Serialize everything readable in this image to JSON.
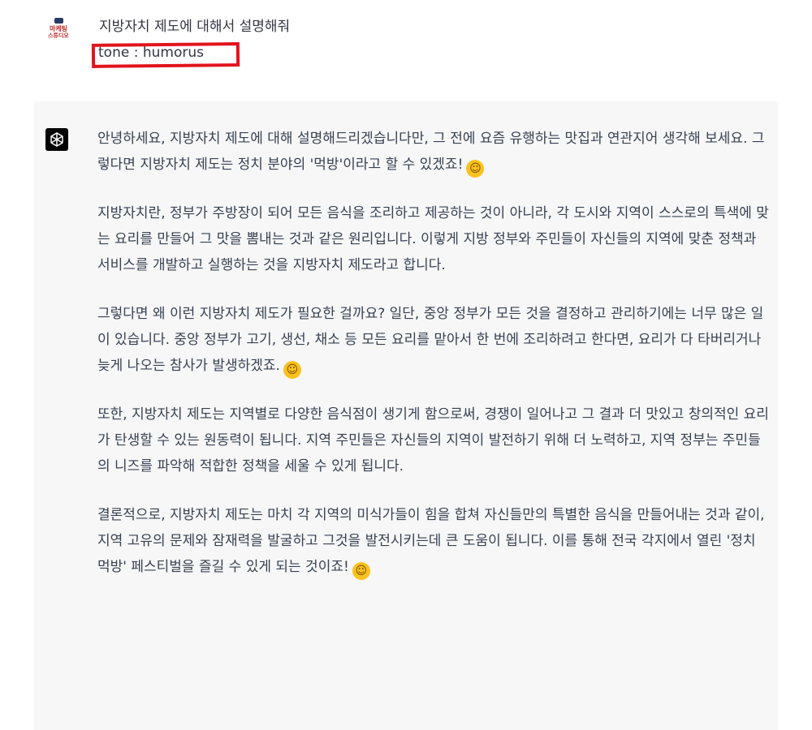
{
  "user": {
    "avatar_text_line1": "마케팅",
    "avatar_text_line2": "스튜디오",
    "question": "지방자치 제도에 대해서 설명해줘",
    "tone": "tone : humorus"
  },
  "assistant": {
    "paragraphs": [
      {
        "text": "안녕하세요, 지방자치 제도에 대해 설명해드리겠습니다만, 그 전에 요즘 유행하는 맛집과 연관지어 생각해 보세요. 그렇다면 지방자치 제도는 정치 분야의 '먹방'이라고 할 수 있겠죠!",
        "emoji": "grinning-face-icon"
      },
      {
        "text": "지방자치란, 정부가 주방장이 되어 모든 음식을 조리하고 제공하는 것이 아니라, 각 도시와 지역이 스스로의 특색에 맞는 요리를 만들어 그 맛을 뽐내는 것과 같은 원리입니다. 이렇게 지방 정부와 주민들이 자신들의 지역에 맞춘 정책과 서비스를 개발하고 실행하는 것을 지방자치 제도라고 합니다."
      },
      {
        "text": "그렇다면 왜 이런 지방자치 제도가 필요한 걸까요? 일단, 중앙 정부가 모든 것을 결정하고 관리하기에는 너무 많은 일이 있습니다. 중앙 정부가 고기, 생선, 채소 등 모든 요리를 맡아서 한 번에 조리하려고 한다면, 요리가 다 타버리거나 늦게 나오는 참사가 발생하겠죠.",
        "emoji": "sweat-smile-icon"
      },
      {
        "text": "또한, 지방자치 제도는 지역별로 다양한 음식점이 생기게 함으로써, 경쟁이 일어나고 그 결과 더 맛있고 창의적인 요리가 탄생할 수 있는 원동력이 됩니다. 지역 주민들은 자신들의 지역이 발전하기 위해 더 노력하고, 지역 정부는 주민들의 니즈를 파악해 적합한 정책을 세울 수 있게 됩니다."
      },
      {
        "text": "결론적으로, 지방자치 제도는 마치 각 지역의 미식가들이 힘을 합쳐 자신들만의 특별한 음식을 만들어내는 것과 같이, 지역 고유의 문제와 잠재력을 발굴하고 그것을 발전시키는데 큰 도움이 됩니다. 이를 통해 전국 각지에서 열린 '정치 먹방' 페스티벌을 즐길 수 있게 되는 것이죠!",
        "emoji": "yum-face-icon"
      }
    ]
  }
}
